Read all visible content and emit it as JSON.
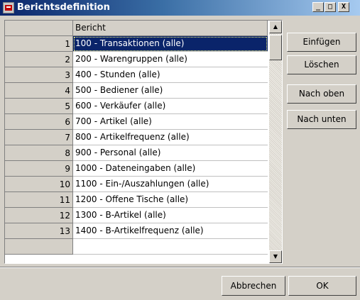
{
  "window": {
    "title": "Berichtsdefinition",
    "controls": [
      "_",
      "□",
      "X"
    ]
  },
  "grid": {
    "header": {
      "row_label": "",
      "column": "Bericht"
    },
    "selected_row": 1,
    "rows": [
      {
        "num": "1",
        "label": "100 - Transaktionen (alle)"
      },
      {
        "num": "2",
        "label": "200 - Warengruppen (alle)"
      },
      {
        "num": "3",
        "label": "400 - Stunden (alle)"
      },
      {
        "num": "4",
        "label": "500 - Bediener (alle)"
      },
      {
        "num": "5",
        "label": "600 - Verkäufer (alle)"
      },
      {
        "num": "6",
        "label": "700 - Artikel (alle)"
      },
      {
        "num": "7",
        "label": "800 - Artikelfrequenz (alle)"
      },
      {
        "num": "8",
        "label": "900 - Personal (alle)"
      },
      {
        "num": "9",
        "label": "1000 - Dateneingaben (alle)"
      },
      {
        "num": "10",
        "label": "1100 - Ein-/Auszahlungen (alle)"
      },
      {
        "num": "11",
        "label": "1200 - Offene Tische (alle)"
      },
      {
        "num": "12",
        "label": "1300 - B-Artikel (alle)"
      },
      {
        "num": "13",
        "label": "1400 - B-Artikelfrequenz (alle)"
      }
    ]
  },
  "buttons": {
    "insert": "Einfügen",
    "delete": "Löschen",
    "move_up": "Nach oben",
    "move_down": "Nach unten",
    "cancel": "Abbrechen",
    "ok": "OK"
  },
  "colors": {
    "selection": "#0a246a",
    "face": "#d4d0c8",
    "title_start": "#0a246a"
  }
}
